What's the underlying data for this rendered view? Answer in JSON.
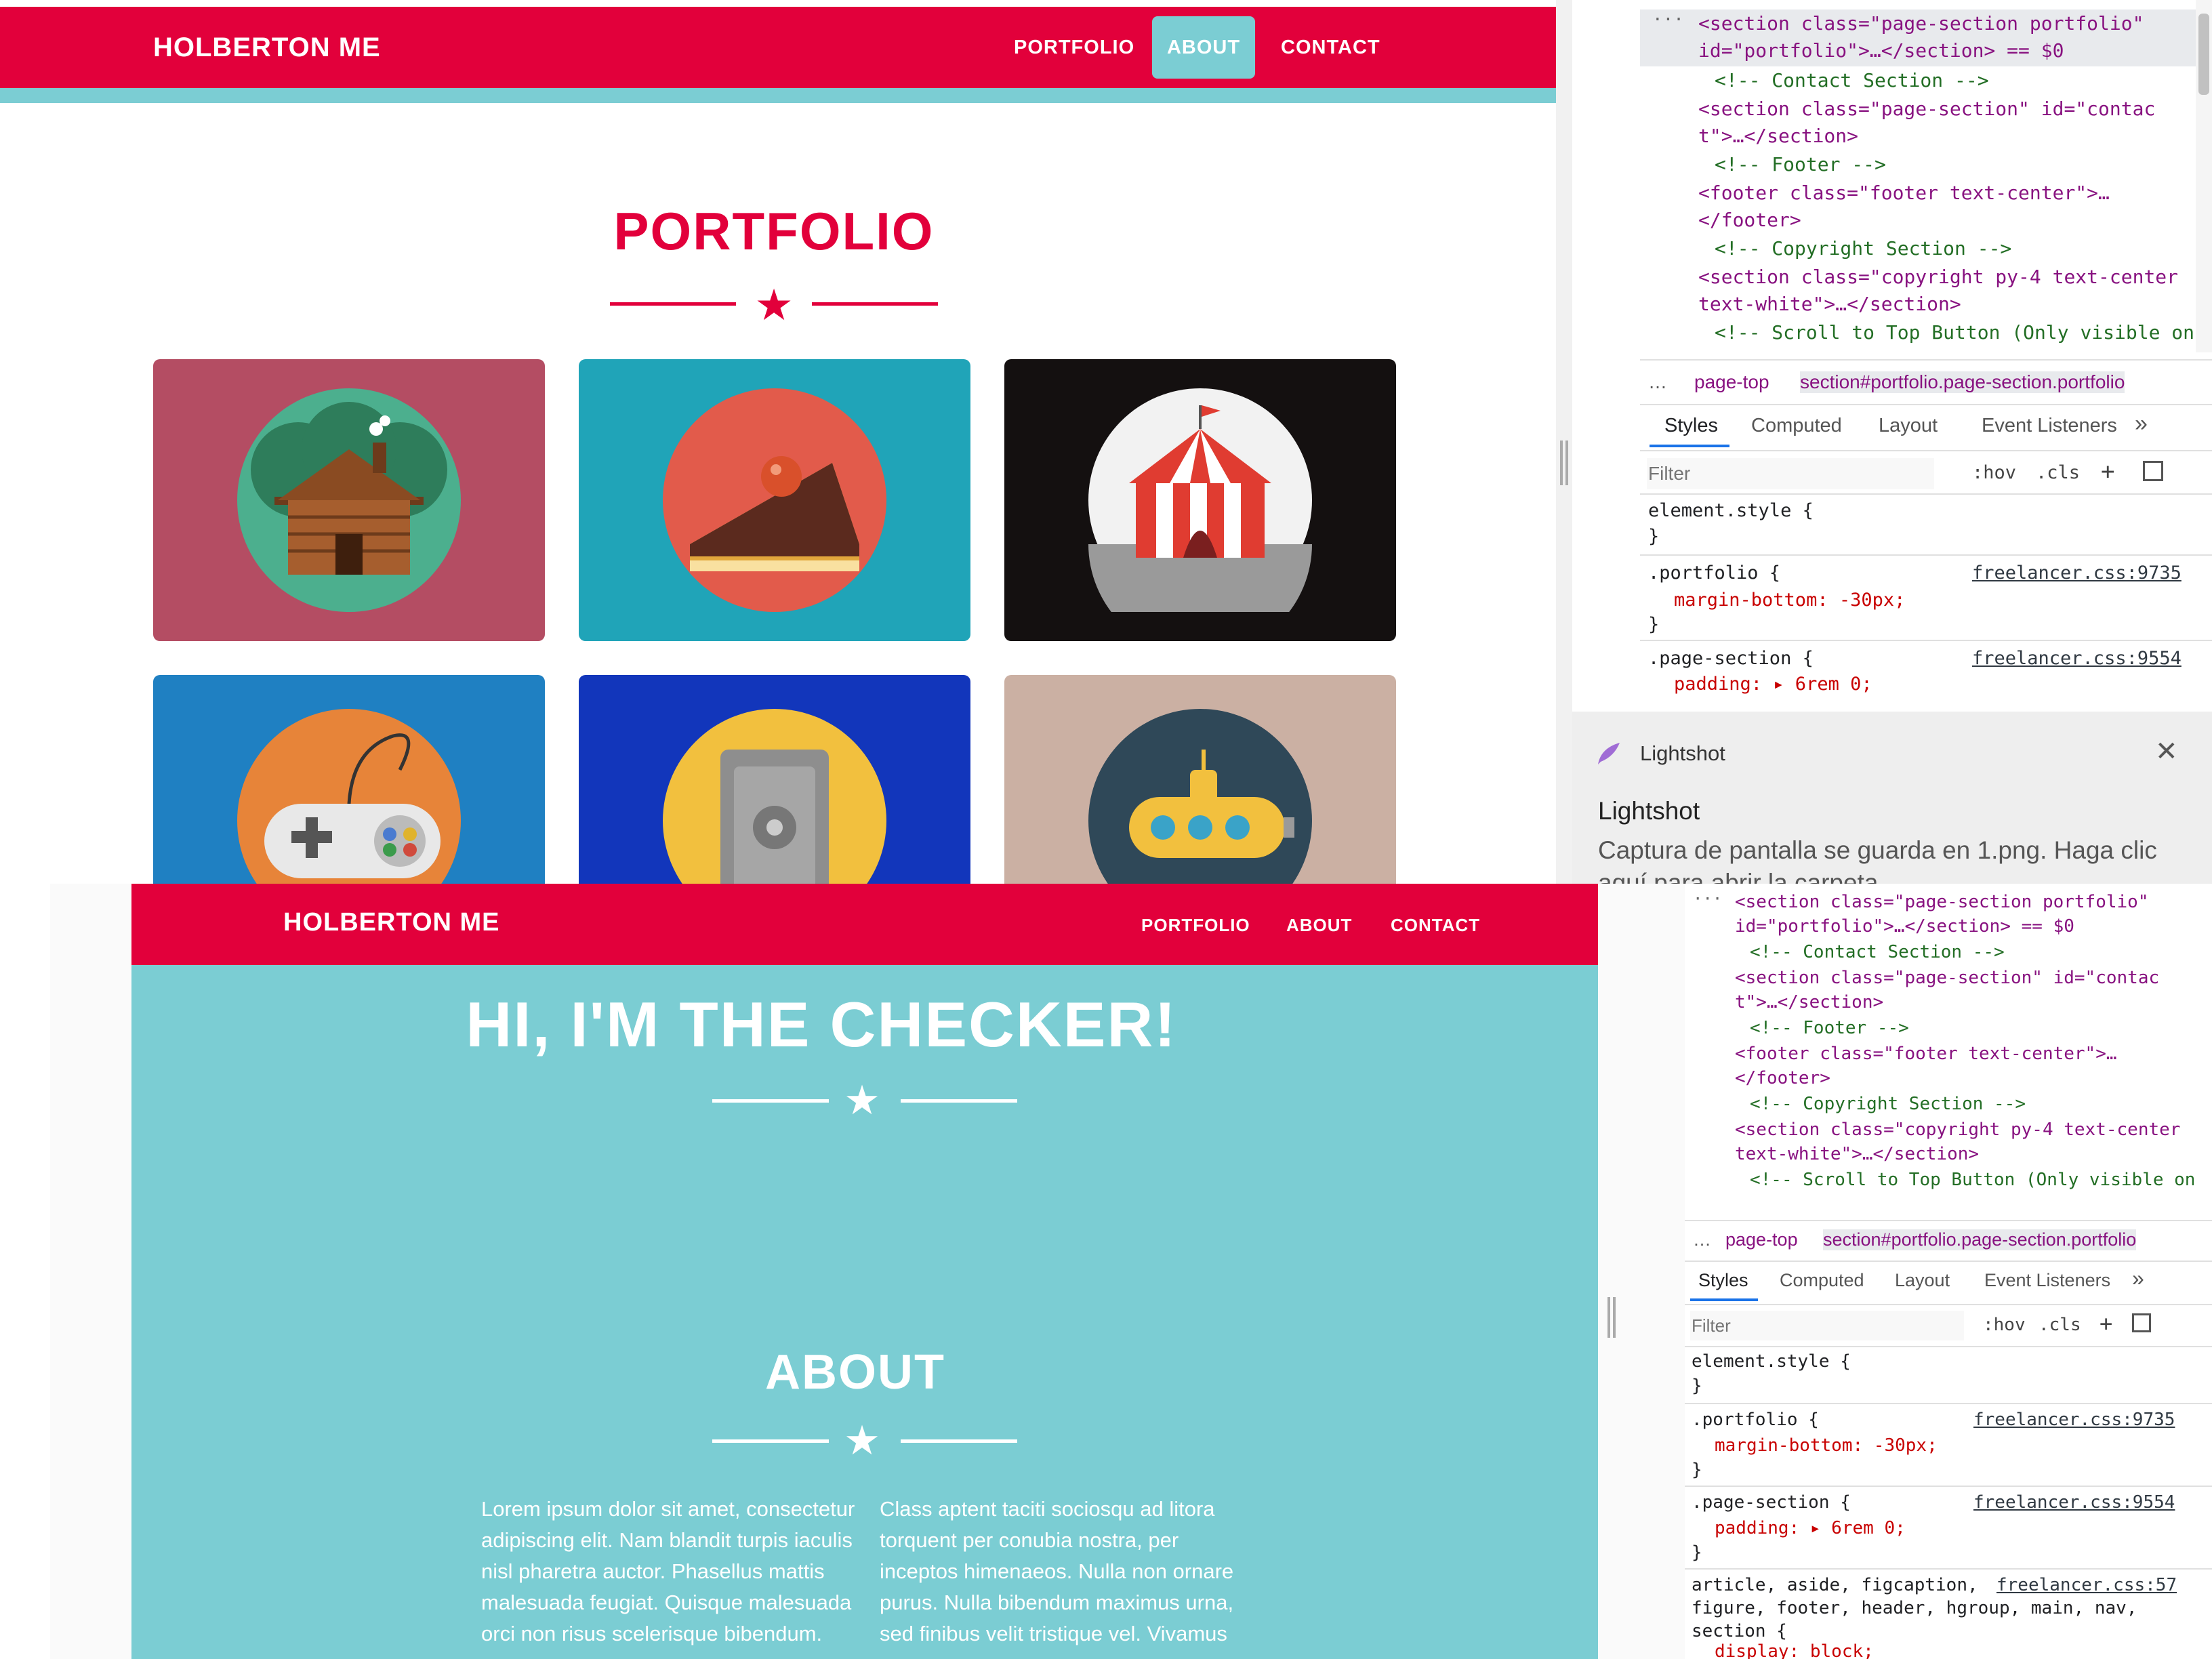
{
  "top_site": {
    "brand": "HOLBERTON ME",
    "nav": [
      "PORTFOLIO",
      "ABOUT",
      "CONTACT"
    ],
    "active_nav": "ABOUT",
    "section_title": "PORTFOLIO",
    "portfolio_items": [
      {
        "icon": "cabin-icon",
        "bg": "#b44d63"
      },
      {
        "icon": "cake-icon",
        "bg": "#20a4b8"
      },
      {
        "icon": "circus-tent-icon",
        "bg": "#141010"
      },
      {
        "icon": "game-controller-icon",
        "bg": "#1f80c2"
      },
      {
        "icon": "safe-icon",
        "bg": "#1236bb"
      },
      {
        "icon": "submarine-icon",
        "bg": "#cbb0a3"
      }
    ],
    "colors": {
      "primary": "#e2003b",
      "accent": "#7bcdd3"
    }
  },
  "devtools": {
    "elements": [
      {
        "t": "tag",
        "text": "<section class=\"page-section portfolio\""
      },
      {
        "t": "tag",
        "text": "id=\"portfolio\">…</section> == $0"
      },
      {
        "t": "cmt",
        "text": "<!-- Contact Section -->"
      },
      {
        "t": "tag",
        "text": "<section class=\"page-section\" id=\"contac"
      },
      {
        "t": "tag",
        "text": "t\">…</section>"
      },
      {
        "t": "cmt",
        "text": "<!-- Footer -->"
      },
      {
        "t": "tag",
        "text": "<footer class=\"footer text-center\">…"
      },
      {
        "t": "tag",
        "text": "</footer>"
      },
      {
        "t": "cmt",
        "text": "<!-- Copyright Section -->"
      },
      {
        "t": "tag",
        "text": "<section class=\"copyright py-4 text-center"
      },
      {
        "t": "tag",
        "text": "text-white\">…</section>"
      },
      {
        "t": "cmt",
        "text": "<!-- Scroll to Top Button (Only visible on"
      }
    ],
    "breadcrumb": [
      "page-top",
      "section#portfolio.page-section.portfolio"
    ],
    "tabs": [
      "Styles",
      "Computed",
      "Layout",
      "Event Listeners"
    ],
    "filter_placeholder": "Filter",
    "filter_buttons": [
      ":hov",
      ".cls",
      "+"
    ],
    "rules": [
      {
        "selector": "element.style {",
        "props": [],
        "src": ""
      },
      {
        "selector": ".portfolio {",
        "props": [
          "margin-bottom: -30px;"
        ],
        "src": "freelancer.css:9735"
      },
      {
        "selector": ".page-section {",
        "props": [
          "padding: ▸ 6rem 0;"
        ],
        "src": "freelancer.css:9554"
      },
      {
        "selector": "article, aside, figcaption,",
        "props": [
          "figure, footer, header, hgroup, main, nav,",
          "section {",
          "display: block;"
        ],
        "src": "freelancer.css:57"
      }
    ]
  },
  "lightshot": {
    "app": "Lightshot",
    "title": "Lightshot",
    "message": "Captura de pantalla se guarda en 1.png. Haga clic",
    "message2": "aquí para abrir la carpeta."
  },
  "bottom_site": {
    "brand": "HOLBERTON ME",
    "nav": [
      "PORTFOLIO",
      "ABOUT",
      "CONTACT"
    ],
    "hero_title": "HI, I'M THE CHECKER!",
    "about_title": "ABOUT",
    "about_left": "Lorem ipsum dolor sit amet, consectetur adipiscing elit. Nam blandit turpis iaculis nisl pharetra auctor. Phasellus mattis malesuada feugiat. Quisque malesuada orci non risus scelerisque bibendum.",
    "about_right": "Class aptent taciti sociosqu ad litora torquent per conubia nostra, per inceptos himenaeos. Nulla non ornare purus. Nulla bibendum maximus urna, sed finibus velit tristique vel. Vivamus"
  }
}
